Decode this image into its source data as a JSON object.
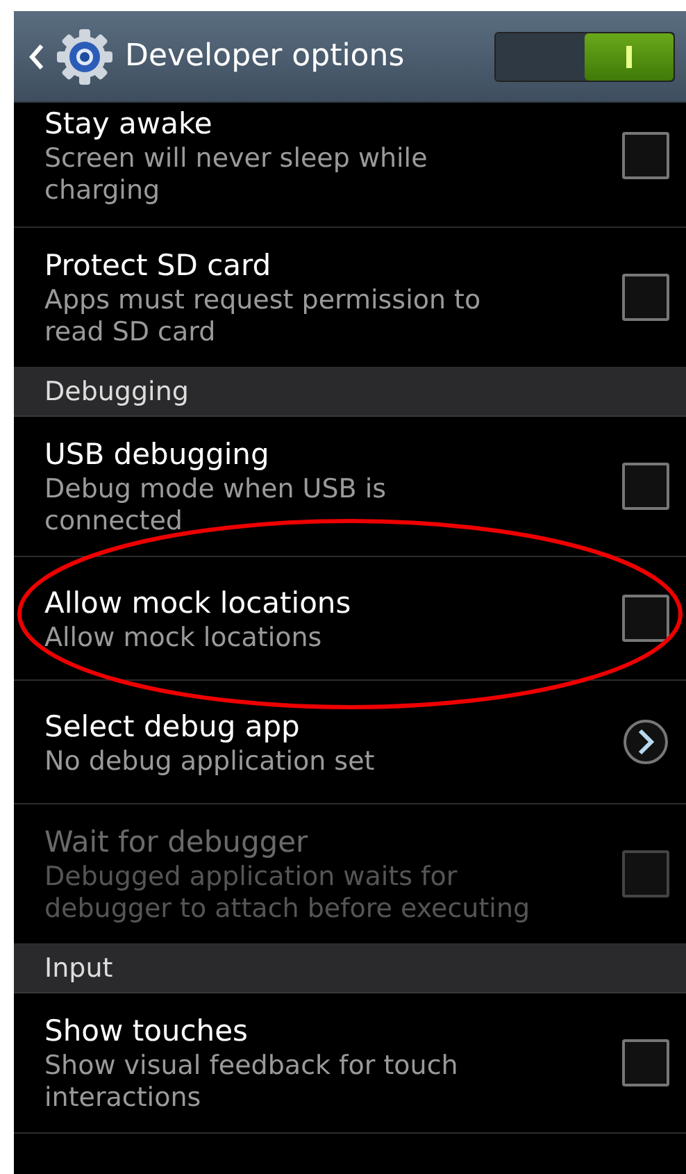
{
  "header": {
    "title": "Developer options",
    "switch_on": true
  },
  "items": [
    {
      "kind": "checkbox",
      "title": "Stay awake",
      "summary": "Screen will never sleep while charging",
      "checked": false,
      "disabled": false
    },
    {
      "kind": "checkbox",
      "title": "Protect SD card",
      "summary": "Apps must request permission to read SD card",
      "checked": false,
      "disabled": false
    },
    {
      "kind": "section",
      "title": "Debugging"
    },
    {
      "kind": "checkbox",
      "title": "USB debugging",
      "summary": "Debug mode when USB is connected",
      "checked": false,
      "disabled": false
    },
    {
      "kind": "checkbox",
      "title": "Allow mock locations",
      "summary": "Allow mock locations",
      "checked": false,
      "disabled": false,
      "highlighted": true
    },
    {
      "kind": "chevron",
      "title": "Select debug app",
      "summary": "No debug application set",
      "disabled": false
    },
    {
      "kind": "checkbox",
      "title": "Wait for debugger",
      "summary": "Debugged application waits for debugger to attach before executing",
      "checked": false,
      "disabled": true
    },
    {
      "kind": "section",
      "title": "Input"
    },
    {
      "kind": "checkbox",
      "title": "Show touches",
      "summary": "Show visual feedback for touch interactions",
      "checked": false,
      "disabled": false
    },
    {
      "kind": "partial"
    }
  ]
}
